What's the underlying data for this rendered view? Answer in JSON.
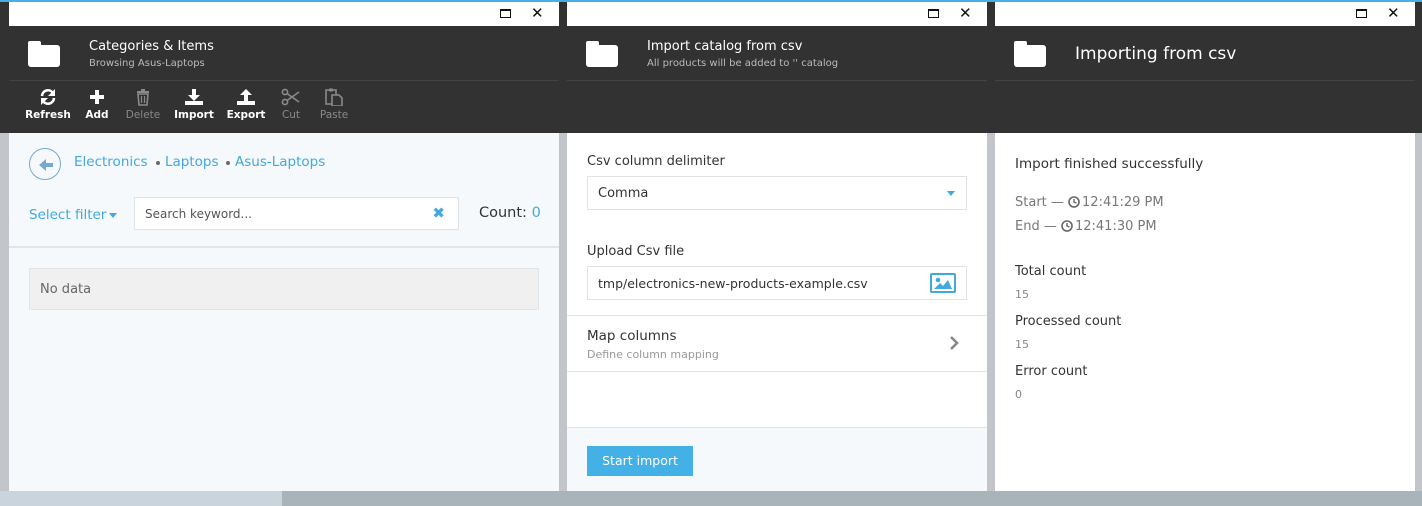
{
  "blades": {
    "categories": {
      "title": "Categories & Items",
      "subtitle": "Browsing Asus-Laptops",
      "toolbar": {
        "refresh": "Refresh",
        "add": "Add",
        "delete": "Delete",
        "import": "Import",
        "export": "Export",
        "cut": "Cut",
        "paste": "Paste"
      },
      "breadcrumb": [
        "Electronics",
        "Laptops",
        "Asus-Laptops"
      ],
      "filter_label": "Select filter",
      "search_placeholder": "Search keyword...",
      "count_label": "Count:",
      "count_value": "0",
      "no_data": "No data"
    },
    "import_csv": {
      "title": "Import catalog from csv",
      "subtitle": "All products will be added to '' catalog",
      "delimiter_label": "Csv column delimiter",
      "delimiter_value": "Comma",
      "upload_label": "Upload Csv file",
      "upload_value": "tmp/electronics-new-products-example.csv",
      "map_title": "Map columns",
      "map_subtitle": "Define column mapping",
      "start_button": "Start import"
    },
    "importing": {
      "title": "Importing from csv",
      "status": "Import finished successfully",
      "start_prefix": "Start —",
      "start_time": "12:41:29 PM",
      "end_prefix": "End —",
      "end_time": "12:41:30 PM",
      "total_label": "Total count",
      "total_value": "15",
      "processed_label": "Processed count",
      "processed_value": "15",
      "error_label": "Error count",
      "error_value": "0"
    }
  },
  "icons": {
    "window_maximize": "maximize-icon",
    "window_close": "close-icon",
    "folder": "folder-icon",
    "refresh": "refresh-icon",
    "add": "plus-icon",
    "delete": "trash-icon",
    "import": "download-icon",
    "export": "upload-icon",
    "cut": "scissors-icon",
    "paste": "paste-icon",
    "back": "arrow-left-icon",
    "image": "image-icon",
    "chevron": "chevron-right-icon",
    "clock": "clock-icon"
  },
  "colors": {
    "accent": "#43b0e6",
    "header_bg": "#323232",
    "disabled_text": "#8a8a8a"
  }
}
